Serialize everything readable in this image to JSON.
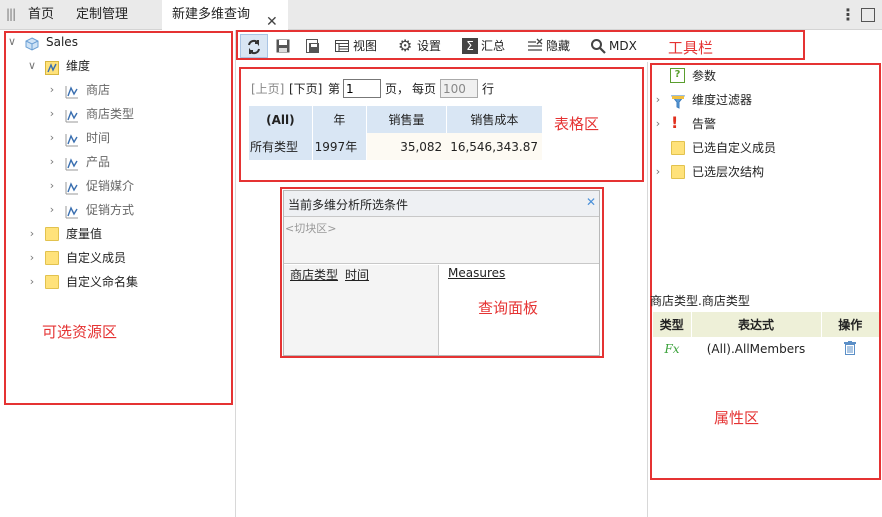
{
  "tabs": [
    {
      "label": "首页"
    },
    {
      "label": "定制管理"
    },
    {
      "label": "新建多维查询"
    }
  ],
  "tree": {
    "root": "Sales",
    "dimension_folder": "维度",
    "dimensions": [
      "商店",
      "商店类型",
      "时间",
      "产品",
      "促销媒介",
      "促销方式"
    ],
    "folders": [
      "度量值",
      "自定义成员",
      "自定义命名集"
    ]
  },
  "toolbar": {
    "refresh": "",
    "view": "视图",
    "settings": "设置",
    "summary": "汇总",
    "hide": "隐藏",
    "mdx": "MDX"
  },
  "pager": {
    "prev": "[上页]",
    "next": "[下页]",
    "page_prefix": "第",
    "page_value": "1",
    "page_suffix": "页，",
    "per_page_prefix": "每页",
    "per_page_value": "100",
    "per_page_suffix": "行"
  },
  "table": {
    "headers": [
      "(All)",
      "年",
      "销售量",
      "销售成本"
    ],
    "row": [
      "所有类型",
      "1997年",
      "35,082",
      "16,546,343.87"
    ]
  },
  "query_panel": {
    "title": "当前多维分析所选条件",
    "slicer": "<切块区>",
    "row_fields": [
      "商店类型",
      "时间"
    ],
    "column_field": "Measures"
  },
  "properties": {
    "items": [
      "参数",
      "维度过滤器",
      "告警",
      "已选自定义成员",
      "已选层次结构"
    ],
    "selected_path": "商店类型.商店类型",
    "headers": [
      "类型",
      "表达式",
      "操作"
    ],
    "row_type": "Fx",
    "row_expression": "(All).AllMembers"
  },
  "annotations": {
    "resources": "可选资源区",
    "toolbar": "工具栏",
    "table": "表格区",
    "query": "查询面板",
    "properties": "属性区"
  },
  "colors": {
    "annotation_red": "#e53333",
    "header_blue": "#d9e6f4",
    "header_green": "#eef0d8",
    "accent_blue": "#2f7fc1"
  }
}
